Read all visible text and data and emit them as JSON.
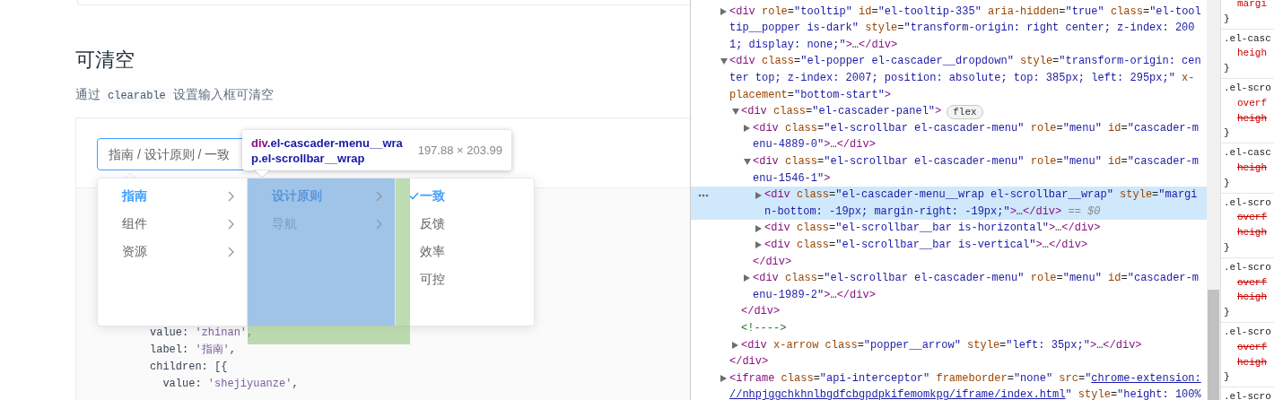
{
  "section": {
    "title": "可清空",
    "description": {
      "before": "通过",
      "code": "clearable",
      "after": "设置输入框可清空"
    }
  },
  "cascader": {
    "value": "指南 / 设计原则 / 一致",
    "focused": true,
    "menus": [
      {
        "highlighted": false,
        "items": [
          {
            "label": "指南",
            "kind": "branch",
            "selected": true
          },
          {
            "label": "组件",
            "kind": "branch",
            "selected": false
          },
          {
            "label": "资源",
            "kind": "branch",
            "selected": false
          }
        ]
      },
      {
        "highlighted": true,
        "items": [
          {
            "label": "设计原则",
            "kind": "branch",
            "selected": true
          },
          {
            "label": "导航",
            "kind": "branch",
            "selected": false
          }
        ]
      },
      {
        "highlighted": false,
        "items": [
          {
            "label": "一致",
            "kind": "leaf",
            "selected": true
          },
          {
            "label": "反馈",
            "kind": "leaf",
            "selected": false
          },
          {
            "label": "效率",
            "kind": "leaf",
            "selected": false
          },
          {
            "label": "可控",
            "kind": "leaf",
            "selected": false
          }
        ]
      }
    ]
  },
  "code_lines": [
    [
      {
        "kind": "plain",
        "text": "value: "
      },
      {
        "kind": "string",
        "text": "'zhinan'"
      },
      {
        "kind": "plain",
        "text": ","
      }
    ],
    [
      {
        "kind": "plain",
        "text": "label: "
      },
      {
        "kind": "string",
        "text": "'指南'"
      },
      {
        "kind": "plain",
        "text": ","
      }
    ],
    [
      {
        "kind": "plain",
        "text": "children: [{"
      }
    ],
    [
      {
        "kind": "plain",
        "text": "  value: "
      },
      {
        "kind": "string",
        "text": "'shejiyuanze'"
      },
      {
        "kind": "plain",
        "text": ","
      }
    ]
  ],
  "inspect_tooltip": {
    "tag": "div",
    "classes": ".el-cascader-menu__wrap.el-scrollbar__wrap",
    "size": "197.88 × 203.99"
  },
  "elements": [
    {
      "kind": "element",
      "expanded": false,
      "selected": false,
      "lines": [
        [
          {
            "kind": "tag",
            "text": "<div"
          },
          {
            "kind": "attr",
            "text": " role"
          },
          {
            "kind": "punct",
            "text": "="
          },
          {
            "kind": "value",
            "text": "\"tooltip\""
          },
          {
            "kind": "attr",
            "text": " id"
          },
          {
            "kind": "punct",
            "text": "="
          },
          {
            "kind": "value",
            "text": "\"el-tooltip-335\""
          },
          {
            "kind": "attr",
            "text": " aria-hidden"
          },
          {
            "kind": "punct",
            "text": "="
          },
          {
            "kind": "value",
            "text": "\"true\""
          },
          {
            "kind": "attr",
            "text": " class"
          },
          {
            "kind": "punct",
            "text": "="
          },
          {
            "kind": "value",
            "text": "\"el-tool"
          }
        ],
        [
          {
            "kind": "value",
            "text": "tip__popper is-dark\""
          },
          {
            "kind": "attr",
            "text": " style"
          },
          {
            "kind": "punct",
            "text": "="
          },
          {
            "kind": "value",
            "text": "\"transform-origin: right center; z-index: 200"
          }
        ],
        [
          {
            "kind": "value",
            "text": "1; display: none;\""
          },
          {
            "kind": "tag",
            "text": ">"
          },
          {
            "kind": "punct",
            "text": "…"
          },
          {
            "kind": "tag",
            "text": "</div>"
          }
        ]
      ]
    },
    {
      "kind": "element",
      "expanded": true,
      "selected": false,
      "lines": [
        [
          {
            "kind": "tag",
            "text": "<div"
          },
          {
            "kind": "attr",
            "text": " class"
          },
          {
            "kind": "punct",
            "text": "="
          },
          {
            "kind": "value",
            "text": "\"el-popper el-cascader__dropdown\""
          },
          {
            "kind": "attr",
            "text": " style"
          },
          {
            "kind": "punct",
            "text": "="
          },
          {
            "kind": "value",
            "text": "\"transform-origin: cen"
          }
        ],
        [
          {
            "kind": "value",
            "text": "ter top; z-index: 2007; position: absolute; top: 385px; left: 295px;\""
          },
          {
            "kind": "attr",
            "text": " x-"
          }
        ],
        [
          {
            "kind": "attr",
            "text": "placement"
          },
          {
            "kind": "punct",
            "text": "="
          },
          {
            "kind": "value",
            "text": "\"bottom-start\""
          },
          {
            "kind": "tag",
            "text": ">"
          }
        ]
      ],
      "children": [
        {
          "kind": "element",
          "expanded": true,
          "selected": false,
          "badge": "flex",
          "lines": [
            [
              {
                "kind": "tag",
                "text": "<div"
              },
              {
                "kind": "attr",
                "text": " class"
              },
              {
                "kind": "punct",
                "text": "="
              },
              {
                "kind": "value",
                "text": "\"el-cascader-panel\""
              },
              {
                "kind": "tag",
                "text": ">"
              }
            ]
          ],
          "children": [
            {
              "kind": "element",
              "expanded": false,
              "selected": false,
              "lines": [
                [
                  {
                    "kind": "tag",
                    "text": "<div"
                  },
                  {
                    "kind": "attr",
                    "text": " class"
                  },
                  {
                    "kind": "punct",
                    "text": "="
                  },
                  {
                    "kind": "value",
                    "text": "\"el-scrollbar el-cascader-menu\""
                  },
                  {
                    "kind": "attr",
                    "text": " role"
                  },
                  {
                    "kind": "punct",
                    "text": "="
                  },
                  {
                    "kind": "value",
                    "text": "\"menu\""
                  },
                  {
                    "kind": "attr",
                    "text": " id"
                  },
                  {
                    "kind": "punct",
                    "text": "="
                  },
                  {
                    "kind": "value",
                    "text": "\"cascader-m"
                  }
                ],
                [
                  {
                    "kind": "value",
                    "text": "enu-4889-0\""
                  },
                  {
                    "kind": "tag",
                    "text": ">"
                  },
                  {
                    "kind": "punct",
                    "text": "…"
                  },
                  {
                    "kind": "tag",
                    "text": "</div>"
                  }
                ]
              ]
            },
            {
              "kind": "element",
              "expanded": true,
              "selected": false,
              "lines": [
                [
                  {
                    "kind": "tag",
                    "text": "<div"
                  },
                  {
                    "kind": "attr",
                    "text": " class"
                  },
                  {
                    "kind": "punct",
                    "text": "="
                  },
                  {
                    "kind": "value",
                    "text": "\"el-scrollbar el-cascader-menu\""
                  },
                  {
                    "kind": "attr",
                    "text": " role"
                  },
                  {
                    "kind": "punct",
                    "text": "="
                  },
                  {
                    "kind": "value",
                    "text": "\"menu\""
                  },
                  {
                    "kind": "attr",
                    "text": " id"
                  },
                  {
                    "kind": "punct",
                    "text": "="
                  },
                  {
                    "kind": "value",
                    "text": "\"cascader-m"
                  }
                ],
                [
                  {
                    "kind": "value",
                    "text": "enu-1546-1\""
                  },
                  {
                    "kind": "tag",
                    "text": ">"
                  }
                ]
              ],
              "children": [
                {
                  "kind": "element",
                  "expanded": false,
                  "selected": true,
                  "lines": [
                    [
                      {
                        "kind": "tag",
                        "text": "<div"
                      },
                      {
                        "kind": "attr",
                        "text": " class"
                      },
                      {
                        "kind": "punct",
                        "text": "="
                      },
                      {
                        "kind": "value",
                        "text": "\"el-cascader-menu__wrap el-scrollbar__wrap\""
                      },
                      {
                        "kind": "attr",
                        "text": " style"
                      },
                      {
                        "kind": "punct",
                        "text": "="
                      },
                      {
                        "kind": "value",
                        "text": "\"margi"
                      }
                    ],
                    [
                      {
                        "kind": "value",
                        "text": "n-bottom: -19px; margin-right: -19px;\""
                      },
                      {
                        "kind": "tag",
                        "text": ">"
                      },
                      {
                        "kind": "punct",
                        "text": "…"
                      },
                      {
                        "kind": "tag",
                        "text": "</div>"
                      },
                      {
                        "kind": "hint",
                        "text": " == $0"
                      }
                    ]
                  ]
                },
                {
                  "kind": "element",
                  "expanded": false,
                  "selected": false,
                  "lines": [
                    [
                      {
                        "kind": "tag",
                        "text": "<div"
                      },
                      {
                        "kind": "attr",
                        "text": " class"
                      },
                      {
                        "kind": "punct",
                        "text": "="
                      },
                      {
                        "kind": "value",
                        "text": "\"el-scrollbar__bar is-horizontal\""
                      },
                      {
                        "kind": "tag",
                        "text": ">"
                      },
                      {
                        "kind": "punct",
                        "text": "…"
                      },
                      {
                        "kind": "tag",
                        "text": "</div>"
                      }
                    ]
                  ]
                },
                {
                  "kind": "element",
                  "expanded": false,
                  "selected": false,
                  "lines": [
                    [
                      {
                        "kind": "tag",
                        "text": "<div"
                      },
                      {
                        "kind": "attr",
                        "text": " class"
                      },
                      {
                        "kind": "punct",
                        "text": "="
                      },
                      {
                        "kind": "value",
                        "text": "\"el-scrollbar__bar is-vertical\""
                      },
                      {
                        "kind": "tag",
                        "text": ">"
                      },
                      {
                        "kind": "punct",
                        "text": "…"
                      },
                      {
                        "kind": "tag",
                        "text": "</div>"
                      }
                    ]
                  ]
                }
              ],
              "closing": [
                {
                  "kind": "tag",
                  "text": "</div>"
                }
              ]
            },
            {
              "kind": "element",
              "expanded": false,
              "selected": false,
              "lines": [
                [
                  {
                    "kind": "tag",
                    "text": "<div"
                  },
                  {
                    "kind": "attr",
                    "text": " class"
                  },
                  {
                    "kind": "punct",
                    "text": "="
                  },
                  {
                    "kind": "value",
                    "text": "\"el-scrollbar el-cascader-menu\""
                  },
                  {
                    "kind": "attr",
                    "text": " role"
                  },
                  {
                    "kind": "punct",
                    "text": "="
                  },
                  {
                    "kind": "value",
                    "text": "\"menu\""
                  },
                  {
                    "kind": "attr",
                    "text": " id"
                  },
                  {
                    "kind": "punct",
                    "text": "="
                  },
                  {
                    "kind": "value",
                    "text": "\"cascader-m"
                  }
                ],
                [
                  {
                    "kind": "value",
                    "text": "enu-1989-2\""
                  },
                  {
                    "kind": "tag",
                    "text": ">"
                  },
                  {
                    "kind": "punct",
                    "text": "…"
                  },
                  {
                    "kind": "tag",
                    "text": "</div>"
                  }
                ]
              ]
            }
          ],
          "closing": [
            {
              "kind": "tag",
              "text": "</div>"
            }
          ]
        },
        {
          "kind": "comment",
          "selected": false,
          "lines": [
            [
              {
                "kind": "comment",
                "text": "<!---->"
              }
            ]
          ]
        },
        {
          "kind": "element",
          "expanded": false,
          "selected": false,
          "lines": [
            [
              {
                "kind": "tag",
                "text": "<div"
              },
              {
                "kind": "attr",
                "text": " x-arrow"
              },
              {
                "kind": "attr",
                "text": " class"
              },
              {
                "kind": "punct",
                "text": "="
              },
              {
                "kind": "value",
                "text": "\"popper__arrow\""
              },
              {
                "kind": "attr",
                "text": " style"
              },
              {
                "kind": "punct",
                "text": "="
              },
              {
                "kind": "value",
                "text": "\"left: 35px;\""
              },
              {
                "kind": "tag",
                "text": ">"
              },
              {
                "kind": "punct",
                "text": "…"
              },
              {
                "kind": "tag",
                "text": "</div>"
              }
            ]
          ]
        }
      ],
      "closing": [
        {
          "kind": "tag",
          "text": "</div>"
        }
      ]
    },
    {
      "kind": "element",
      "expanded": false,
      "selected": false,
      "lines": [
        [
          {
            "kind": "tag",
            "text": "<iframe"
          },
          {
            "kind": "attr",
            "text": " class"
          },
          {
            "kind": "punct",
            "text": "="
          },
          {
            "kind": "value",
            "text": "\"api-interceptor\""
          },
          {
            "kind": "attr",
            "text": " frameborder"
          },
          {
            "kind": "punct",
            "text": "="
          },
          {
            "kind": "value",
            "text": "\"none\""
          },
          {
            "kind": "attr",
            "text": " src"
          },
          {
            "kind": "punct",
            "text": "="
          },
          {
            "kind": "value",
            "text": "\""
          },
          {
            "kind": "link",
            "text": "chrome-extension:"
          }
        ],
        [
          {
            "kind": "link",
            "text": "//nhpjggchkhnlbgdfcbgpdpkifemomkpg/iframe/index.html"
          },
          {
            "kind": "value",
            "text": "\""
          },
          {
            "kind": "attr",
            "text": " style"
          },
          {
            "kind": "punct",
            "text": "="
          },
          {
            "kind": "value",
            "text": "\"height: 100%"
          }
        ]
      ]
    }
  ],
  "styles_pane": {
    "rules": [
      {
        "properties": [
          {
            "name": "margi",
            "struck": false
          }
        ],
        "closing": "}"
      },
      {
        "selector": ".el-casc",
        "properties": [
          {
            "name": "heigh",
            "struck": false
          }
        ],
        "closing": "}"
      },
      {
        "selector": ".el-scro",
        "properties": [
          {
            "name": "overf",
            "struck": false
          },
          {
            "name": "heigh",
            "struck": true
          }
        ],
        "closing": "}"
      },
      {
        "selector": ".el-casc",
        "properties": [
          {
            "name": "heigh",
            "struck": true
          }
        ],
        "closing": "}"
      },
      {
        "selector": ".el-scro",
        "properties": [
          {
            "name": "overf",
            "struck": true
          },
          {
            "name": "heigh",
            "struck": true
          }
        ],
        "closing": "}"
      },
      {
        "selector": ".el-scro",
        "properties": [
          {
            "name": "overf",
            "struck": true
          },
          {
            "name": "heigh",
            "struck": true
          }
        ],
        "closing": "}"
      },
      {
        "selector": ".el-scro",
        "properties": [
          {
            "name": "overf",
            "struck": true
          },
          {
            "name": "heigh",
            "struck": true
          }
        ],
        "closing": "}"
      },
      {
        "selector": ".el-scro"
      }
    ]
  }
}
